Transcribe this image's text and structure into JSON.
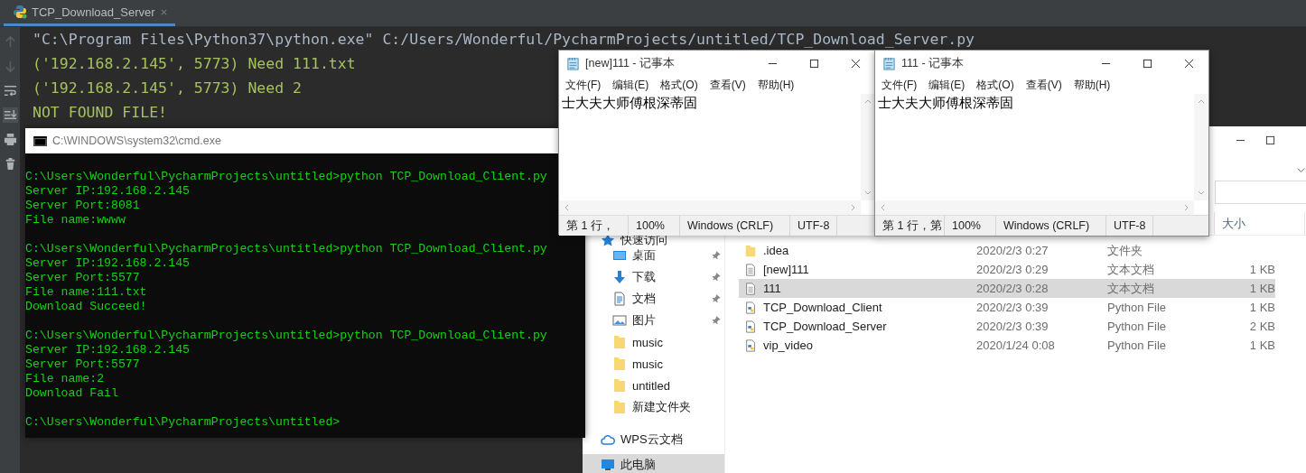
{
  "pycharm": {
    "tab": {
      "label": "TCP_Download_Server",
      "selected": true
    },
    "console": [
      {
        "kind": "command",
        "text": "\"C:\\Program Files\\Python37\\python.exe\" C:/Users/Wonderful/PycharmProjects/untitled/TCP_Download_Server.py"
      },
      {
        "kind": "output",
        "text": "('192.168.2.145', 5773) Need 111.txt"
      },
      {
        "kind": "output",
        "text": "('192.168.2.145', 5773) Need 2"
      },
      {
        "kind": "output",
        "text": "NOT FOUND FILE!"
      }
    ]
  },
  "explorer": {
    "size_header": "大小",
    "nav": [
      {
        "label": "快速访问",
        "kind": "star",
        "pinned": false,
        "selected": false
      },
      {
        "label": "桌面",
        "kind": "desktop",
        "pinned": true,
        "selected": false
      },
      {
        "label": "下载",
        "kind": "download",
        "pinned": true,
        "selected": false
      },
      {
        "label": "文档",
        "kind": "document",
        "pinned": true,
        "selected": false
      },
      {
        "label": "图片",
        "kind": "pictures",
        "pinned": true,
        "selected": false
      },
      {
        "label": "music",
        "kind": "folder",
        "pinned": false,
        "selected": false
      },
      {
        "label": "music",
        "kind": "folder",
        "pinned": false,
        "selected": false
      },
      {
        "label": "untitled",
        "kind": "folder",
        "pinned": false,
        "selected": false
      },
      {
        "label": "新建文件夹",
        "kind": "folder",
        "pinned": false,
        "selected": false
      },
      {
        "label": "WPS云文档",
        "kind": "cloud",
        "pinned": false,
        "selected": false
      },
      {
        "label": "此电脑",
        "kind": "computer",
        "pinned": false,
        "selected": true
      }
    ],
    "files": [
      {
        "name": ".idea",
        "date": "2020/2/3 0:27",
        "type": "文件夹",
        "kind": "folder",
        "selected": false
      },
      {
        "name": "[new]111",
        "date": "2020/2/3 0:29",
        "type": "文本文档",
        "size": "1 KB",
        "kind": "text",
        "selected": false
      },
      {
        "name": "111",
        "date": "2020/2/3 0:28",
        "type": "文本文档",
        "size": "1 KB",
        "kind": "text",
        "selected": true
      },
      {
        "name": "TCP_Download_Client",
        "date": "2020/2/3 0:39",
        "type": "Python File",
        "size": "1 KB",
        "kind": "python",
        "selected": false
      },
      {
        "name": "TCP_Download_Server",
        "date": "2020/2/3 0:39",
        "type": "Python File",
        "size": "2 KB",
        "kind": "python",
        "selected": false
      },
      {
        "name": "vip_video",
        "date": "2020/1/24 0:08",
        "type": "Python File",
        "size": "1 KB",
        "kind": "python",
        "selected": false
      }
    ]
  },
  "cmd": {
    "title": "C:\\WINDOWS\\system32\\cmd.exe",
    "blocks": [
      [
        "C:\\Users\\Wonderful\\PycharmProjects\\untitled>python TCP_Download_Client.py",
        "Server IP:192.168.2.145",
        "Server Port:8081",
        "File name:wwww"
      ],
      [
        "C:\\Users\\Wonderful\\PycharmProjects\\untitled>python TCP_Download_Client.py",
        "Server IP:192.168.2.145",
        "Server Port:5577",
        "File name:111.txt",
        "Download Succeed!"
      ],
      [
        "C:\\Users\\Wonderful\\PycharmProjects\\untitled>python TCP_Download_Client.py",
        "Server IP:192.168.2.145",
        "Server Port:5577",
        "File name:2",
        "Download Fail"
      ],
      [
        "C:\\Users\\Wonderful\\PycharmProjects\\untitled>"
      ]
    ]
  },
  "notepads": [
    {
      "title": "[new]111 - 记事本",
      "menu": [
        "文件(F)",
        "编辑(E)",
        "格式(O)",
        "查看(V)",
        "帮助(H)"
      ],
      "content": "士大夫大师傅根深蒂固",
      "status": [
        "第 1 行，",
        "100%",
        "Windows (CRLF)",
        "UTF-8"
      ]
    },
    {
      "title": "111 - 记事本",
      "menu": [
        "文件(F)",
        "编辑(E)",
        "格式(O)",
        "查看(V)",
        "帮助(H)"
      ],
      "content": "士大夫大师傅根深蒂固",
      "status": [
        "第 1 行，第",
        "100%",
        "Windows (CRLF)",
        "UTF-8"
      ]
    }
  ]
}
